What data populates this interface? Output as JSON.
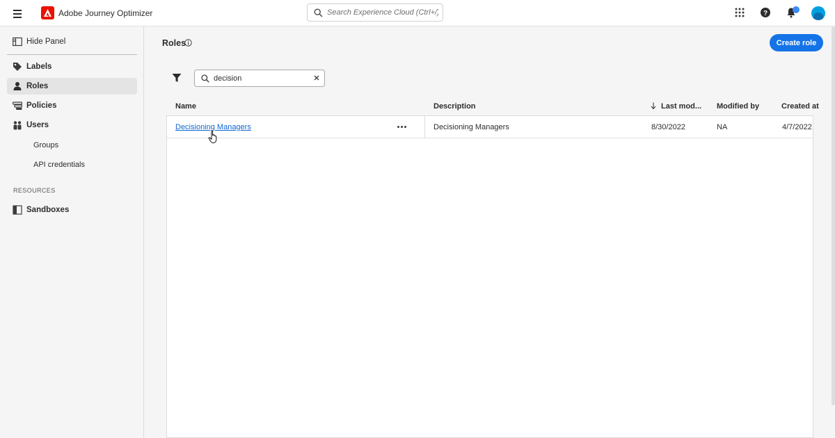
{
  "header": {
    "app_title": "Adobe Journey Optimizer",
    "search_placeholder": "Search Experience Cloud (Ctrl+/)"
  },
  "sidebar": {
    "hide_panel": "Hide Panel",
    "items": [
      {
        "label": "Labels",
        "icon": "tag-icon"
      },
      {
        "label": "Roles",
        "icon": "user-icon",
        "active": true
      },
      {
        "label": "Policies",
        "icon": "policy-icon"
      },
      {
        "label": "Users",
        "icon": "users-icon"
      }
    ],
    "sub_items": [
      "Groups",
      "API credentials"
    ],
    "resources_heading": "RESOURCES",
    "resources": [
      {
        "label": "Sandboxes",
        "icon": "sandbox-icon"
      }
    ]
  },
  "main": {
    "title": "Roles",
    "create_button": "Create role",
    "search_value": "decision",
    "columns": [
      "Name",
      "Description",
      "Last mod...",
      "Modified by",
      "Created at"
    ],
    "rows": [
      {
        "name": "Decisioning Managers",
        "description": "Decisioning Managers",
        "last_modified": "8/30/2022",
        "modified_by": "NA",
        "created_at": "4/7/2022"
      }
    ]
  },
  "colors": {
    "accent": "#1473e6",
    "brand": "#eb1000",
    "link": "#0d66d0"
  }
}
